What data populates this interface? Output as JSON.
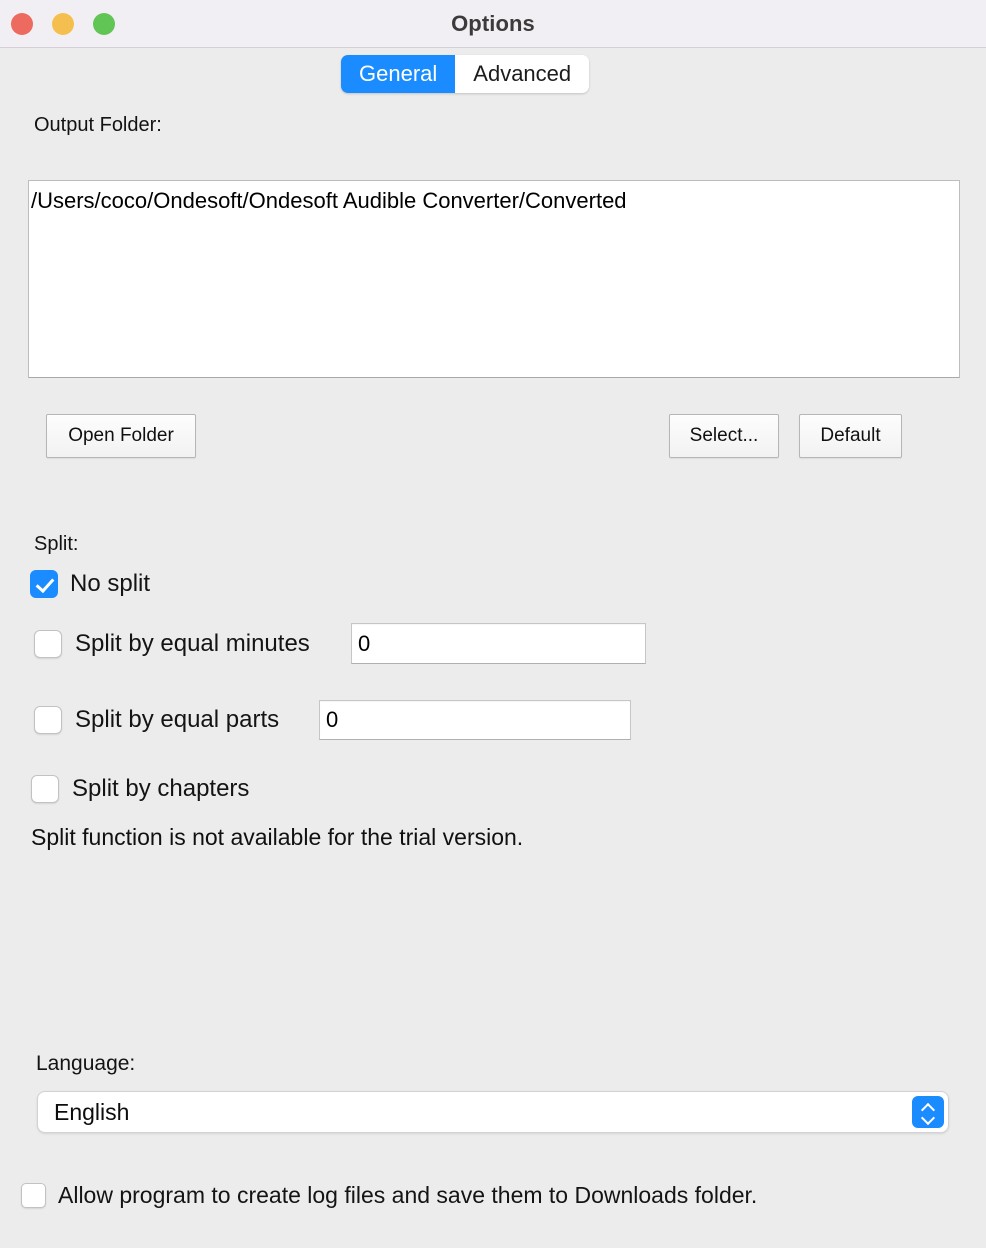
{
  "window": {
    "title": "Options",
    "traffic_lights": [
      {
        "name": "close",
        "color": "#ec6a5f"
      },
      {
        "name": "minimize",
        "color": "#f5bf4f"
      },
      {
        "name": "zoom",
        "color": "#61c555"
      }
    ],
    "accent_color": "#1a8cff",
    "background_color": "#ececec",
    "titlebar_color": "#f2eff4"
  },
  "tabs": [
    {
      "label": "General",
      "active": true
    },
    {
      "label": "Advanced",
      "active": false
    }
  ],
  "output": {
    "label": "Output Folder:",
    "path": "/Users/coco/Ondesoft/Ondesoft Audible Converter/Converted",
    "buttons": {
      "open_folder": "Open Folder",
      "select": "Select...",
      "default": "Default"
    }
  },
  "split": {
    "label": "Split:",
    "options": [
      {
        "label": "No split",
        "checked": true,
        "has_input": false
      },
      {
        "label": "Split by equal minutes",
        "checked": false,
        "has_input": true,
        "value": "0"
      },
      {
        "label": "Split by equal parts",
        "checked": false,
        "has_input": true,
        "value": "0"
      },
      {
        "label": "Split by chapters",
        "checked": false,
        "has_input": false
      }
    ],
    "notice": "Split function is not available for the trial version."
  },
  "language": {
    "label": "Language:",
    "selected": "English",
    "stepper_icon": "chevron-up-down-icon"
  },
  "logging": {
    "label": "Allow program to create log files and save them to Downloads folder.",
    "checked": false
  }
}
